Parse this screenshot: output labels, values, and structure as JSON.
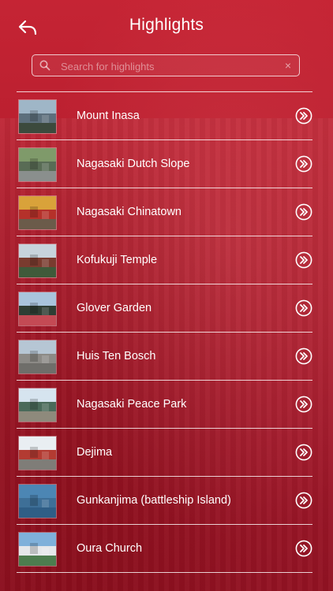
{
  "header": {
    "title": "Highlights",
    "back_icon": "back-arrow-icon"
  },
  "search": {
    "placeholder": "Search for highlights",
    "value": "",
    "clear_symbol": "×"
  },
  "colors": {
    "background": "#b71d2c",
    "text": "#ffffff"
  },
  "items": [
    {
      "label": "Mount Inasa",
      "thumb": {
        "sky": "#9fb6c7",
        "mid": "#5d6f7c",
        "low": "#3c4a3d"
      }
    },
    {
      "label": "Nagasaki Dutch Slope",
      "thumb": {
        "sky": "#7f9a6a",
        "mid": "#596c55",
        "low": "#8a8f8d"
      }
    },
    {
      "label": "Nagasaki Chinatown",
      "thumb": {
        "sky": "#d9a23a",
        "mid": "#b5312a",
        "low": "#6b5b4a"
      }
    },
    {
      "label": "Kofukuji Temple",
      "thumb": {
        "sky": "#c7d3dc",
        "mid": "#7a3b2f",
        "low": "#3f5a3a"
      }
    },
    {
      "label": "Glover Garden",
      "thumb": {
        "sky": "#a9c4dc",
        "mid": "#2f3e34",
        "low": "#c44a54"
      }
    },
    {
      "label": "Huis Ten Bosch",
      "thumb": {
        "sky": "#b6c6d4",
        "mid": "#8c8a86",
        "low": "#6f6e6a"
      }
    },
    {
      "label": "Nagasaki Peace Park",
      "thumb": {
        "sky": "#d6e4ef",
        "mid": "#4a6a5a",
        "low": "#8e8a7c"
      }
    },
    {
      "label": "Dejima",
      "thumb": {
        "sky": "#e9eef2",
        "mid": "#b33b32",
        "low": "#7f7d78"
      }
    },
    {
      "label": "Gunkanjima (battleship Island)",
      "thumb": {
        "sky": "#4c86b4",
        "mid": "#3e6f97",
        "low": "#2f5e86"
      }
    },
    {
      "label": "Oura Church",
      "thumb": {
        "sky": "#7fb0da",
        "mid": "#e5e7ea",
        "low": "#4d7d4f"
      }
    }
  ]
}
